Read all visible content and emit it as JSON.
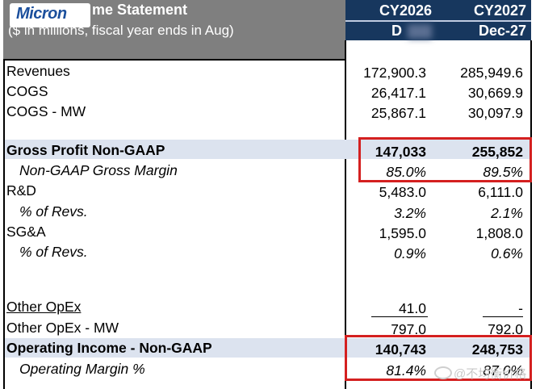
{
  "header": {
    "logo_text": "Micron",
    "title": "me Statement",
    "subtitle": "($ in millions, fiscal year ends in Aug)",
    "columns": [
      {
        "year": "CY2026",
        "period": "D"
      },
      {
        "year": "CY2027",
        "period": "Dec-27"
      }
    ]
  },
  "rows": [
    {
      "label": "Revenues",
      "v1": "172,900.3",
      "v2": "285,949.6"
    },
    {
      "label": "COGS",
      "v1": "26,417.1",
      "v2": "30,669.9"
    },
    {
      "label": "COGS - MW",
      "v1": "25,867.1",
      "v2": "30,097.9"
    },
    {
      "label": "Gross Profit Non-GAAP",
      "v1": "147,033",
      "v2": "255,852"
    },
    {
      "label": "Non-GAAP Gross Margin",
      "v1": "85.0%",
      "v2": "89.5%"
    },
    {
      "label": "R&D",
      "v1": "5,483.0",
      "v2": "6,111.0"
    },
    {
      "label": "% of Revs.",
      "v1": "3.2%",
      "v2": "2.1%"
    },
    {
      "label": "SG&A",
      "v1": "1,595.0",
      "v2": "1,808.0"
    },
    {
      "label": "% of Revs.",
      "v1": "0.9%",
      "v2": "0.6%"
    },
    {
      "label": "Other OpEx",
      "v1": "41.0",
      "v2": "-"
    },
    {
      "label": "Other OpEx - MW",
      "v1": "797.0",
      "v2": "792.0"
    },
    {
      "label": "Operating Income - Non-GAAP",
      "v1": "140,743",
      "v2": "248,753"
    },
    {
      "label": "Operating Margin %",
      "v1": "81.4%",
      "v2": "87.0%"
    }
  ],
  "watermark": "@不均衡价格",
  "colors": {
    "header_gray": "#7f7f7f",
    "header_navy": "#17375e",
    "band": "#dce3ef",
    "highlight_red": "#d42020",
    "logo_blue": "#1b4f9c"
  }
}
